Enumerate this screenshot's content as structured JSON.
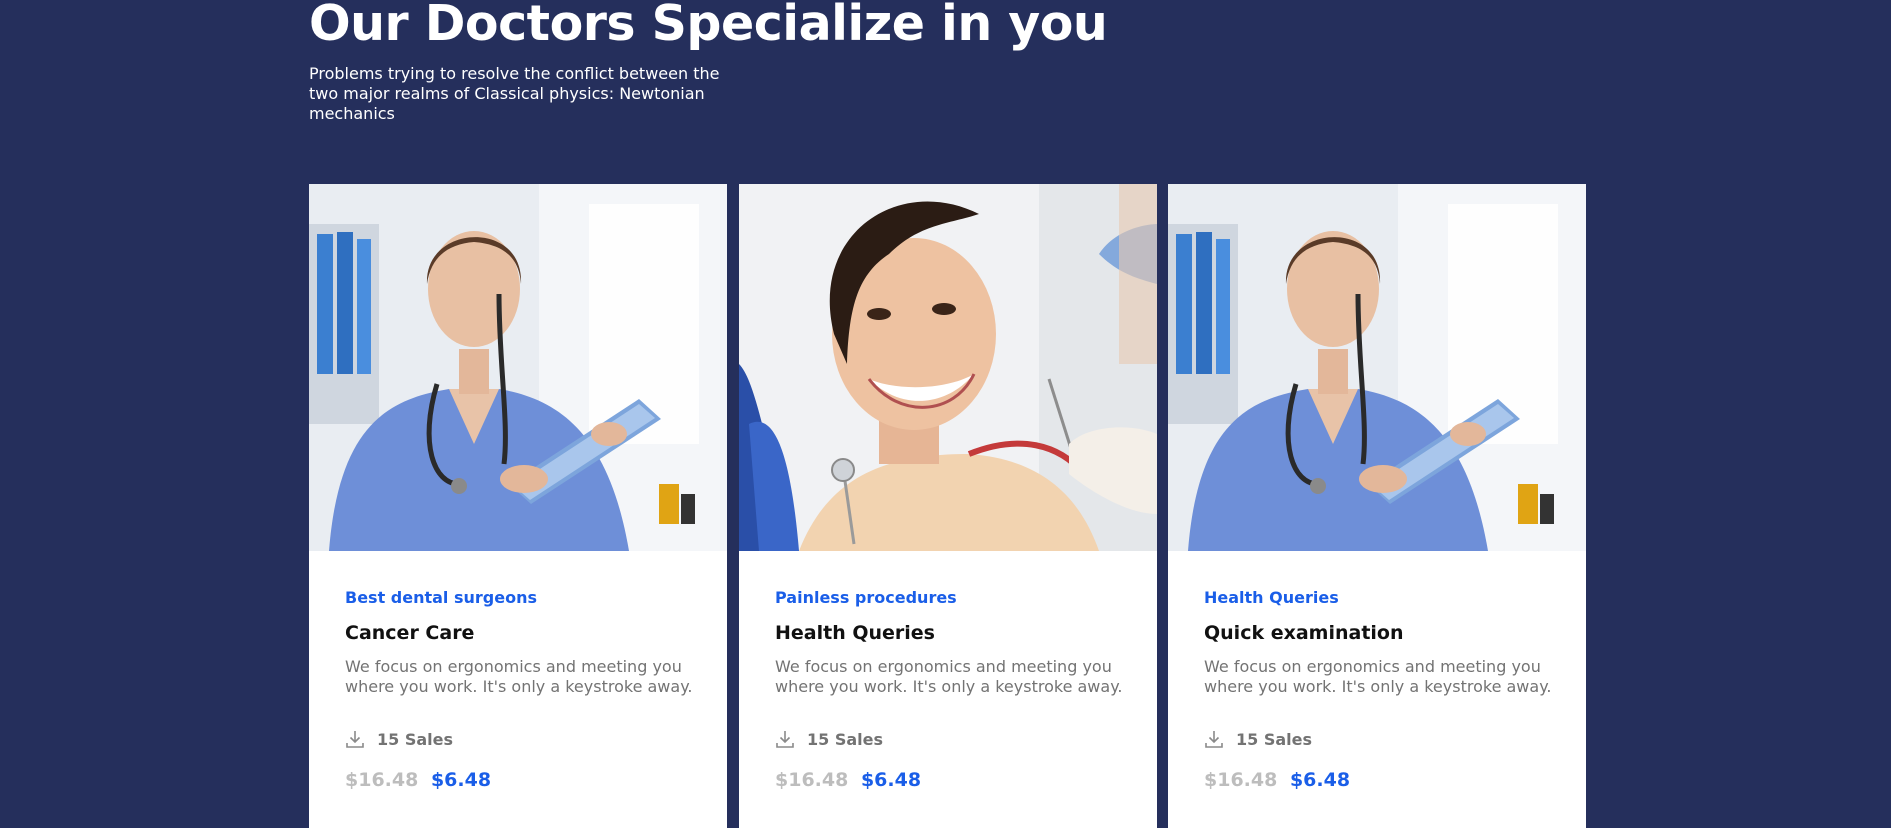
{
  "section": {
    "title": "Our Doctors Specialize in you",
    "subtitle": "Problems trying to resolve the conflict between the two major realms of Classical physics: Newtonian mechanics"
  },
  "colors": {
    "background": "#252f5c",
    "accent": "#1a5ee8",
    "card": "#ffffff",
    "muted_text": "#737373",
    "old_price": "#bdbdbd"
  },
  "cards": [
    {
      "image": "doctor-with-tablet-photo",
      "category": "Best dental surgeons",
      "title": "Cancer Care",
      "description": "We focus on ergonomics and meeting you where you work. It's only a keystroke away.",
      "sales_icon": "download-icon",
      "sales": "15 Sales",
      "old_price": "$16.48",
      "new_price": "$6.48"
    },
    {
      "image": "smiling-dental-patient-photo",
      "category": "Painless procedures",
      "title": "Health Queries",
      "description": "We focus on ergonomics and meeting you where you work. It's only a keystroke away.",
      "sales_icon": "download-icon",
      "sales": "15 Sales",
      "old_price": "$16.48",
      "new_price": "$6.48"
    },
    {
      "image": "doctor-with-tablet-photo",
      "category": "Health Queries",
      "title": "Quick examination",
      "description": "We focus on ergonomics and meeting you where you work. It's only a keystroke away.",
      "sales_icon": "download-icon",
      "sales": "15 Sales",
      "old_price": "$16.48",
      "new_price": "$6.48"
    }
  ]
}
